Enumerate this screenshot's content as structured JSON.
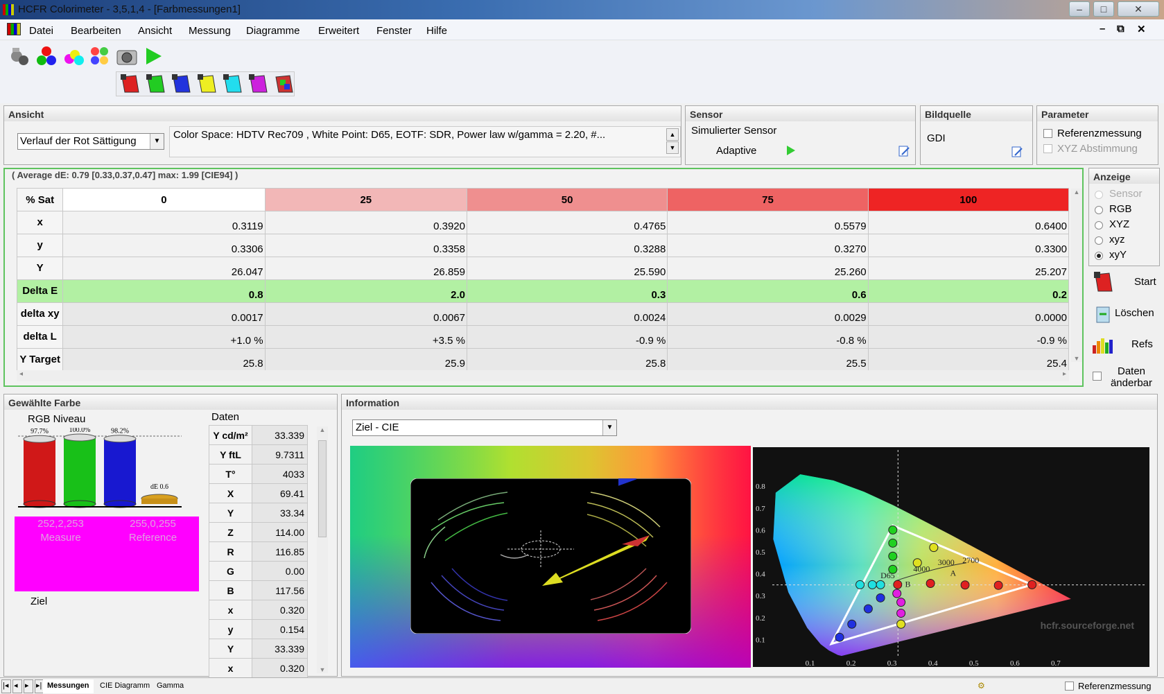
{
  "window": {
    "title": "HCFR Colorimeter - 3,5,1,4 - [Farbmessungen1]"
  },
  "menu": [
    "Datei",
    "Bearbeiten",
    "Ansicht",
    "Messung",
    "Diagramme",
    "Erweitert",
    "Fenster",
    "Hilfe"
  ],
  "mdi_controls": [
    "–",
    "⧉",
    "✕"
  ],
  "ansicht": {
    "title": "Ansicht",
    "view_select": "Verlauf der Rot Sättigung",
    "description": "Color Space: HDTV Rec709 , White Point: D65, EOTF:  SDR, Power law w/gamma = 2.20, #..."
  },
  "sensor": {
    "title": "Sensor",
    "name": "Simulierter Sensor",
    "mode": "Adaptive"
  },
  "bildquelle": {
    "title": "Bildquelle",
    "source": "GDI"
  },
  "parameter": {
    "title": "Parameter",
    "ref": "Referenzmessung",
    "xyz": "XYZ Abstimmung"
  },
  "summary": "( Average dE: 0.79 [0.33,0.37,0.47] max: 1.99 [CIE94] )",
  "table": {
    "corner": "% Sat",
    "columns": [
      "0",
      "25",
      "50",
      "75",
      "100"
    ],
    "column_colors": [
      "#ffffff",
      "#f2b7b7",
      "#ef8f8f",
      "#ee6363",
      "#ee2424"
    ],
    "rows": [
      {
        "label": "x",
        "values": [
          "0.3119",
          "0.3920",
          "0.4765",
          "0.5579",
          "0.6400"
        ]
      },
      {
        "label": "y",
        "values": [
          "0.3306",
          "0.3358",
          "0.3288",
          "0.3270",
          "0.3300"
        ]
      },
      {
        "label": "Y",
        "values": [
          "26.047",
          "26.859",
          "25.590",
          "25.260",
          "25.207"
        ]
      },
      {
        "label": "Delta E",
        "values": [
          "0.8",
          "2.0",
          "0.3",
          "0.6",
          "0.2"
        ]
      },
      {
        "label": "delta xy",
        "values": [
          "0.0017",
          "0.0067",
          "0.0024",
          "0.0029",
          "0.0000"
        ]
      },
      {
        "label": "delta L",
        "values": [
          "+1.0 %",
          "+3.5 %",
          "-0.9 %",
          "-0.8 %",
          "-0.9 %"
        ]
      },
      {
        "label": "Y Target",
        "values": [
          "25.8",
          "25.9",
          "25.8",
          "25.5",
          "25.4"
        ]
      }
    ]
  },
  "anzeige": {
    "title": "Anzeige",
    "options": [
      "Sensor",
      "RGB",
      "XYZ",
      "xyz",
      "xyY"
    ],
    "selected": "xyY",
    "buttons": [
      "Start",
      "Löschen",
      "Refs"
    ],
    "editable": "Daten änderbar"
  },
  "gewaehlte": {
    "title": "Gewählte Farbe",
    "rgb_label": "RGB Niveau",
    "bars": [
      {
        "label": "97.7%",
        "value": 97.7,
        "color": "#d01818"
      },
      {
        "label": "100.0%",
        "value": 100.0,
        "color": "#18c018"
      },
      {
        "label": "98.2%",
        "value": 98.2,
        "color": "#1818d0"
      }
    ],
    "de_label": "dE 0.6",
    "measure_rgb": "252,2,253",
    "measure_label": "Measure",
    "ref_rgb": "255,0,255",
    "ref_label": "Reference",
    "swatch_color": "#ff00ff",
    "ziel": "Ziel"
  },
  "daten": {
    "title": "Daten",
    "rows": [
      {
        "k": "Y cd/m²",
        "v": "33.339"
      },
      {
        "k": "Y ftL",
        "v": "9.7311"
      },
      {
        "k": "T°",
        "v": "4033"
      },
      {
        "k": "X",
        "v": "69.41"
      },
      {
        "k": "Y",
        "v": "33.34"
      },
      {
        "k": "Z",
        "v": "114.00"
      },
      {
        "k": "R",
        "v": "116.85"
      },
      {
        "k": "G",
        "v": "0.00"
      },
      {
        "k": "B",
        "v": "117.56"
      },
      {
        "k": "x",
        "v": "0.320"
      },
      {
        "k": "y",
        "v": "0.154"
      },
      {
        "k": "Y",
        "v": "33.339"
      },
      {
        "k": "x",
        "v": "0.320"
      }
    ]
  },
  "information": {
    "title": "Information",
    "select": "Ziel - CIE",
    "cie_yticks": [
      "0.8",
      "0.7",
      "0.6",
      "0.5",
      "0.4",
      "0.3",
      "0.2",
      "0.1"
    ],
    "cie_xticks": [
      "0.1",
      "0.2",
      "0.3",
      "0.4",
      "0.5",
      "0.6",
      "0.7"
    ],
    "watermark": "hcfr.sourceforge.net",
    "cct_labels": [
      "D65",
      "4000",
      "3000",
      "2700",
      "A",
      "B"
    ]
  },
  "status": {
    "tabs": [
      "Messungen",
      "CIE Diagramm",
      "Gamma"
    ],
    "ref": "Referenzmessung"
  }
}
